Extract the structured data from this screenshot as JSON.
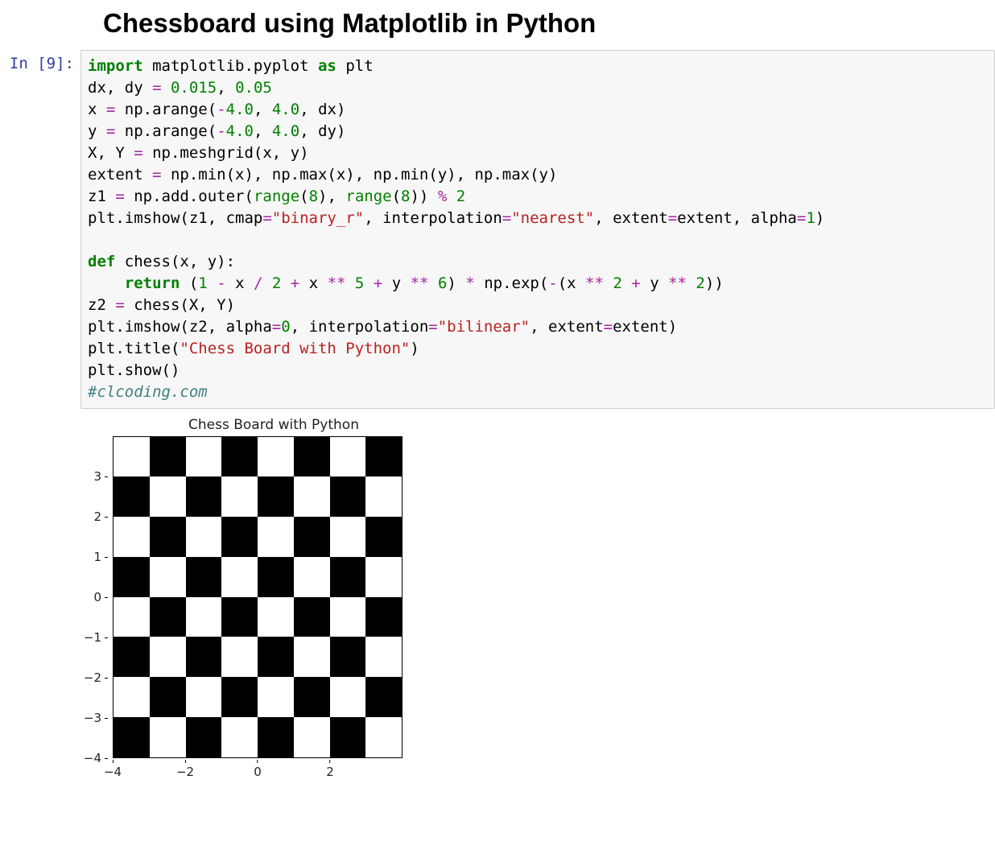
{
  "heading": "Chessboard using Matplotlib in Python",
  "prompt": "In [9]:",
  "code": {
    "l1a": "import",
    "l1b": " matplotlib.pyplot ",
    "l1c": "as",
    "l1d": " plt",
    "l2a": "dx, dy ",
    "l2b": "=",
    "l2c": " ",
    "l2d": "0.015",
    "l2e": ", ",
    "l2f": "0.05",
    "l3a": "x ",
    "l3b": "=",
    "l3c": " np.arange(",
    "l3d": "-",
    "l3e": "4.0",
    "l3f": ", ",
    "l3g": "4.0",
    "l3h": ", dx)",
    "l4a": "y ",
    "l4b": "=",
    "l4c": " np.arange(",
    "l4d": "-",
    "l4e": "4.0",
    "l4f": ", ",
    "l4g": "4.0",
    "l4h": ", dy)",
    "l5a": "X, Y ",
    "l5b": "=",
    "l5c": " np.meshgrid(x, y)",
    "l6a": "extent ",
    "l6b": "=",
    "l6c": " np.min(x), np.max(x), np.min(y), np.max(y)",
    "l7a": "z1 ",
    "l7b": "=",
    "l7c": " np.add.outer(",
    "l7d": "range",
    "l7e": "(",
    "l7f": "8",
    "l7g": "), ",
    "l7h": "range",
    "l7i": "(",
    "l7j": "8",
    "l7k": ")) ",
    "l7l": "%",
    "l7m": " ",
    "l7n": "2",
    "l8a": "plt.imshow(z1, cmap",
    "l8b": "=",
    "l8c": "\"binary_r\"",
    "l8d": ", interpolation",
    "l8e": "=",
    "l8f": "\"nearest\"",
    "l8g": ", extent",
    "l8h": "=",
    "l8i": "extent, alpha",
    "l8j": "=",
    "l8k": "1",
    "l8l": ")",
    "l10a": "def",
    "l10b": " chess(x, y):",
    "l11a": "    ",
    "l11b": "return",
    "l11c": " (",
    "l11d": "1",
    "l11e": " ",
    "l11f": "-",
    "l11g": " x ",
    "l11h": "/",
    "l11i": " ",
    "l11j": "2",
    "l11k": " ",
    "l11l": "+",
    "l11m": " x ",
    "l11n": "**",
    "l11o": " ",
    "l11p": "5",
    "l11q": " ",
    "l11r": "+",
    "l11s": " y ",
    "l11t": "**",
    "l11u": " ",
    "l11v": "6",
    "l11w": ") ",
    "l11x": "*",
    "l11y": " np.exp(",
    "l11z": "-",
    "l11aa": "(x ",
    "l11ab": "**",
    "l11ac": " ",
    "l11ad": "2",
    "l11ae": " ",
    "l11af": "+",
    "l11ag": " y ",
    "l11ah": "**",
    "l11ai": " ",
    "l11aj": "2",
    "l11ak": "))",
    "l12a": "z2 ",
    "l12b": "=",
    "l12c": " chess(X, Y)",
    "l13a": "plt.imshow(z2, alpha",
    "l13b": "=",
    "l13c": "0",
    "l13d": ", interpolation",
    "l13e": "=",
    "l13f": "\"bilinear\"",
    "l13g": ", extent",
    "l13h": "=",
    "l13i": "extent)",
    "l14a": "plt.title(",
    "l14b": "\"Chess Board with Python\"",
    "l14c": ")",
    "l15a": "plt.show()",
    "l16a": "#clcoding.com"
  },
  "chart_data": {
    "type": "heatmap",
    "title": "Chess Board with Python",
    "grid_size": 8,
    "pattern": "checkerboard",
    "cmap": "binary_r",
    "square_values": [
      [
        0,
        1,
        0,
        1,
        0,
        1,
        0,
        1
      ],
      [
        1,
        0,
        1,
        0,
        1,
        0,
        1,
        0
      ],
      [
        0,
        1,
        0,
        1,
        0,
        1,
        0,
        1
      ],
      [
        1,
        0,
        1,
        0,
        1,
        0,
        1,
        0
      ],
      [
        0,
        1,
        0,
        1,
        0,
        1,
        0,
        1
      ],
      [
        1,
        0,
        1,
        0,
        1,
        0,
        1,
        0
      ],
      [
        0,
        1,
        0,
        1,
        0,
        1,
        0,
        1
      ],
      [
        1,
        0,
        1,
        0,
        1,
        0,
        1,
        0
      ]
    ],
    "xlim": [
      -4,
      4
    ],
    "ylim": [
      -4,
      4
    ],
    "x_ticks": [
      -4,
      -2,
      0,
      2
    ],
    "y_ticks": [
      -4,
      -3,
      -2,
      -1,
      0,
      1,
      2,
      3
    ],
    "x_tick_labels": [
      "−4",
      "−2",
      "0",
      "2"
    ],
    "y_tick_labels": [
      "−4",
      "−3",
      "−2",
      "−1",
      "0",
      "1",
      "2",
      "3"
    ]
  }
}
